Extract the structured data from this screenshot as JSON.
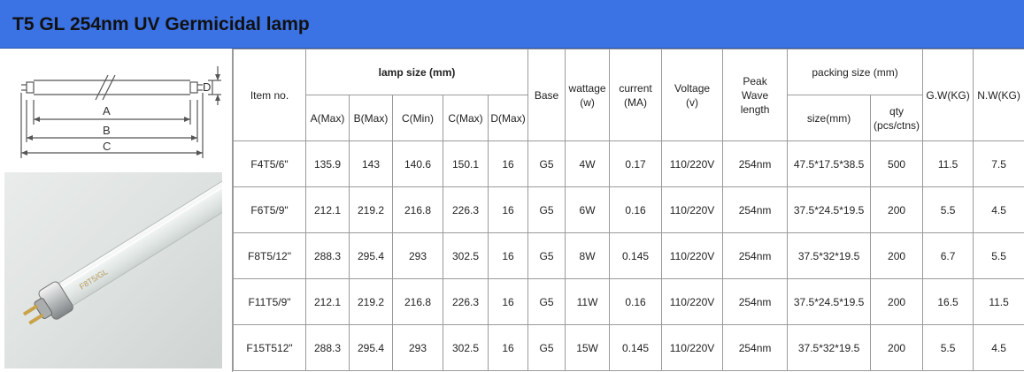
{
  "title": "T5 GL 254nm UV Germicidal lamp",
  "diagram": {
    "labels": {
      "a": "A",
      "b": "B",
      "c": "C",
      "d": "D"
    }
  },
  "photo": {
    "lamp_print": "F8T5/GL"
  },
  "table": {
    "headers": {
      "item_no": "Item no.",
      "lamp_size": "lamp size (mm)",
      "a_max": "A(Max)",
      "b_max": "B(Max)",
      "c_min": "C(Min)",
      "c_max": "C(Max)",
      "d_max": "D(Max)",
      "base": "Base",
      "wattage_line1": "wattage",
      "wattage_line2": "(w)",
      "current_line1": "current",
      "current_line2": "(MA)",
      "voltage_line1": "Voltage",
      "voltage_line2": "(v)",
      "peak_line1": "Peak",
      "peak_line2": "Wave",
      "peak_line3": "length",
      "packing_size": "packing size (mm)",
      "size": "size(mm)",
      "qty_line1": "qty",
      "qty_line2": "(pcs/ctns)",
      "gw": "G.W(KG)",
      "nw": "N.W(KG)"
    },
    "rows": [
      {
        "item": "F4T5/6\"",
        "a": "135.9",
        "b": "143",
        "c_min": "140.6",
        "c_max": "150.1",
        "d": "16",
        "base": "G5",
        "wattage": "4W",
        "current": "0.17",
        "voltage": "110/220V",
        "peak": "254nm",
        "size": "47.5*17.5*38.5",
        "qty": "500",
        "gw": "11.5",
        "nw": "7.5"
      },
      {
        "item": "F6T5/9\"",
        "a": "212.1",
        "b": "219.2",
        "c_min": "216.8",
        "c_max": "226.3",
        "d": "16",
        "base": "G5",
        "wattage": "6W",
        "current": "0.16",
        "voltage": "110/220V",
        "peak": "254nm",
        "size": "37.5*24.5*19.5",
        "qty": "200",
        "gw": "5.5",
        "nw": "4.5"
      },
      {
        "item": "F8T5/12\"",
        "a": "288.3",
        "b": "295.4",
        "c_min": "293",
        "c_max": "302.5",
        "d": "16",
        "base": "G5",
        "wattage": "8W",
        "current": "0.145",
        "voltage": "110/220V",
        "peak": "254nm",
        "size": "37.5*32*19.5",
        "qty": "200",
        "gw": "6.7",
        "nw": "5.5"
      },
      {
        "item": "F11T5/9\"",
        "a": "212.1",
        "b": "219.2",
        "c_min": "216.8",
        "c_max": "226.3",
        "d": "16",
        "base": "G5",
        "wattage": "11W",
        "current": "0.16",
        "voltage": "110/220V",
        "peak": "254nm",
        "size": "37.5*24.5*19.5",
        "qty": "200",
        "gw": "16.5",
        "nw": "11.5"
      },
      {
        "item": "F15T512\"",
        "a": "288.3",
        "b": "295.4",
        "c_min": "293",
        "c_max": "302.5",
        "d": "16",
        "base": "G5",
        "wattage": "15W",
        "current": "0.145",
        "voltage": "110/220V",
        "peak": "254nm",
        "size": "37.5*32*19.5",
        "qty": "200",
        "gw": "5.5",
        "nw": "4.5"
      }
    ]
  }
}
